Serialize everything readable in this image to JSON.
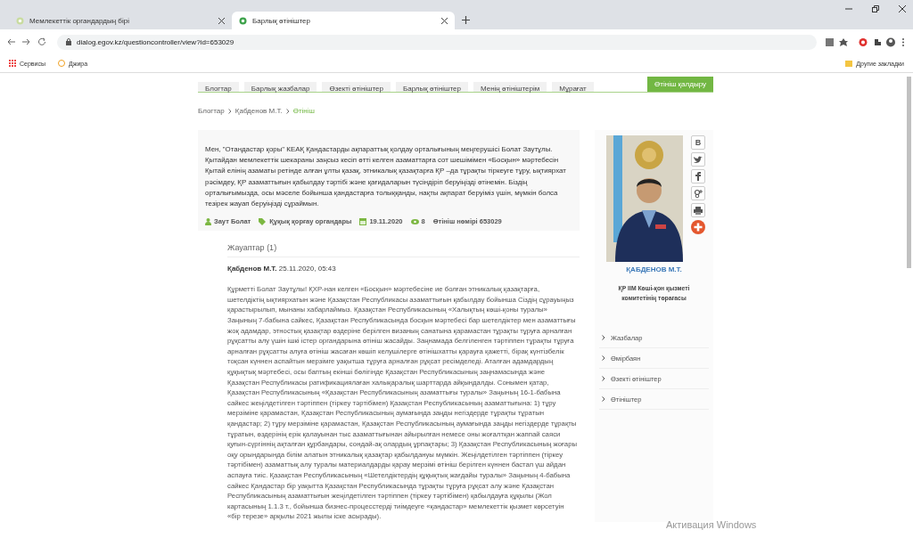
{
  "browser": {
    "tabs": [
      {
        "title": "Мемлекеттік органдардың бірі",
        "selected": false
      },
      {
        "title": "Барлық өтініштер",
        "selected": true
      }
    ],
    "url": "dialog.egov.kz/questioncontroller/view?id=653029",
    "bookmarks": [
      "Сервисы",
      "Джира"
    ],
    "other_bookmarks": "Другие закладки"
  },
  "nav": {
    "items": [
      {
        "label": "Блогтар",
        "selected": false
      },
      {
        "label": "Барлық жазбалар",
        "selected": false
      },
      {
        "label": "Өзекті өтініштер",
        "selected": false
      },
      {
        "label": "Барлық өтініштер",
        "selected": false
      },
      {
        "label": "Менің өтініштерім",
        "selected": false
      },
      {
        "label": "Мұрағат",
        "selected": false
      }
    ],
    "action": "Өтініш қалдыру"
  },
  "breadcrumb": [
    "Блогтар",
    "Қабденов М.Т.",
    "Өтініш"
  ],
  "question": {
    "text": "Мен, \"Отандастар қоры\" КЕАҚ Қандастарды ақпараттық қолдау орталығының меңгерушісі Болат Заутұлы. Қытайдан мемлекеттік шекараны заңсыз кесіп өтті келген азаматтарға сот шешімімен «Босқын» мәртебесін Қытай елінің азаматы ретінде алған ұлты қазақ, этникалық қазақтарға ҚР –да тұрақты тіркеуге тұру, ықтиярхат рәсімдеу, ҚР азаматтығын қабылдау тәртібі және қағидаларын түсіндіріп беруіңізді өтінемін. Біздің орталығымызда, осы мәселе бойынша қандастарға толыққанды, нақты ақпарат беруіміз үшін, мүмкін болса тезірек жауап беруіңізді сұраймын.",
    "meta": [
      {
        "kind": "author",
        "text": "Заут Болат"
      },
      {
        "kind": "category",
        "text": "Құқық қорғау органдары"
      },
      {
        "kind": "date",
        "text": "19.11.2020"
      },
      {
        "kind": "views",
        "text": "8"
      },
      {
        "kind": "number",
        "text": "Өтініш нөмірі 653029"
      }
    ]
  },
  "answers": {
    "title": "Жауаптар (1)",
    "items": [
      {
        "author": "Қабденов М.Т.",
        "date": "25.11.2020, 05:43",
        "text": "Құрметті Болат Заутұлы! ҚХР-нан келген «Босқын» мәртебесіне ие болған этникалық қазақтарға, шетелдіктің ықтиярхатын және Қазақстан Республикасы азаматтығын қабылдау бойынша Сіздің сұрауыңыз қарастырылып, мынаны хабарлаймыз. Қазақстан Республикасының «Халықтың көші-қоны туралы» Заңының 7-бабына сайкес, Қазақстан Республикасында босқын мәртебесі бар шетелдіктер мен азаматтығы жоқ адамдар, этностық қазақтар өздеріне берілген визаның санатына қарамастан тұрақты тұруға арналған рұқсатты алу үшін ішкі істер органдарына өтініш жасайды. Заңнамада белгіленген тәртіппен тұрақты тұруға арналған рұқсатты алуға өтініш жасаған көшіп келушілерге өтінішхатты қарауға қажетті, бірақ күнтізбелік тоқсан күннен аспайтын мерзімге уақытша тұруға арналған рұқсат ресімделеді. Аталған адамдардың құқықтық мәртебесі, осы баптың екінші бөлігінде Қазақстан Республикасының заңнамасында және Қазақстан Республикасы ратификациялаған халықаралық шарттарда айқындалды. Сонымен қатар, Қазақстан Республикасының «Қазақстан Республикасының азаматтығы туралы» Заңының 16-1-бабына сайкес жеңілдетілген тәртіппен (тіркеу тәртібімен) Қазақстан Республикасының азаматтығына: 1) тұру мерзіміне қарамастан, Қазақстан Республикасының аумағында заңды негіздерде тұрақты тұратын қандастар; 2) тұру мерзіміне қарамастан, Қазақстан Республикасының аумағында заңды негіздерде тұрақты тұратын, өздерінің ерік қалауынан тыс азаматтығынан айырылған немесе оны жоғалтқан жаппай саяси қуғын-сүргіннің ақталған құрбандары, сондай-ақ олардың ұрпақтары; 3) Қазақстан Республикасының жоғары оқу орындарында білім алатын этникалық қазақтар қабылдануы мүмкін. Жеңілдетілген тәртіппен (тіркеу тәртібімен) азаматтық алу туралы материалдарды қарау мерзімі өтініш берілген күннен бастап үш айдан аспауға тиіс. Қазақстан Республикасының «Шетелдіктердің құқықтық жағдайы туралы» Заңының 4-бабына сайкес Қандастар бір уақытта Қазақстан Республикасында тұрақты тұруға рұқсат алу және Қазақстан Республикасының азаматтығын жеңілдетілген тәртіппен (тіркеу тәртібімен) қабылдауға құқылы (Жол картасының 1.1.3 т., бойынша бизнес-процесстерді тиімдеуге «қандастар» мемлекеттік қызмет көрсетуін «бір терезе» арқылы 2021 жылы іске асырады)."
      }
    ]
  },
  "profile": {
    "share": [
      {
        "kind": "vk",
        "text": "В"
      },
      {
        "kind": "twitter"
      },
      {
        "kind": "facebook"
      },
      {
        "kind": "gplus"
      },
      {
        "kind": "print"
      },
      {
        "kind": "add"
      }
    ],
    "name": "ҚАБДЕНОВ М.Т.",
    "position": "ҚР ІІМ Көші-қон қызметі комитетінің төрағасы",
    "menu": [
      "Жазбалар",
      "Өмірбаян",
      "Өзекті өтініштер",
      "Өтініштер"
    ]
  },
  "os_notice": "Активация Windows"
}
